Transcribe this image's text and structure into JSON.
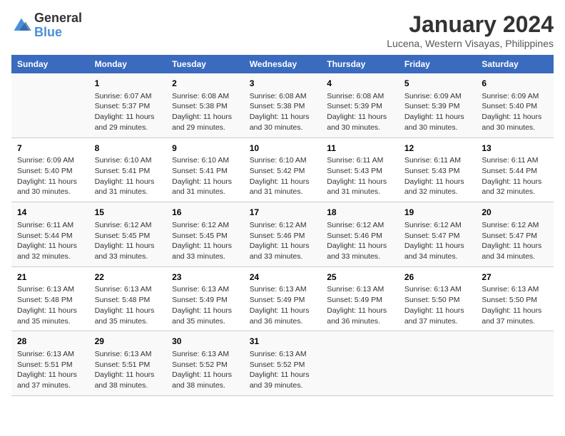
{
  "logo": {
    "text_general": "General",
    "text_blue": "Blue"
  },
  "title": "January 2024",
  "subtitle": "Lucena, Western Visayas, Philippines",
  "header": {
    "days": [
      "Sunday",
      "Monday",
      "Tuesday",
      "Wednesday",
      "Thursday",
      "Friday",
      "Saturday"
    ]
  },
  "weeks": [
    [
      {
        "day": "",
        "info": ""
      },
      {
        "day": "1",
        "info": "Sunrise: 6:07 AM\nSunset: 5:37 PM\nDaylight: 11 hours\nand 29 minutes."
      },
      {
        "day": "2",
        "info": "Sunrise: 6:08 AM\nSunset: 5:38 PM\nDaylight: 11 hours\nand 29 minutes."
      },
      {
        "day": "3",
        "info": "Sunrise: 6:08 AM\nSunset: 5:38 PM\nDaylight: 11 hours\nand 30 minutes."
      },
      {
        "day": "4",
        "info": "Sunrise: 6:08 AM\nSunset: 5:39 PM\nDaylight: 11 hours\nand 30 minutes."
      },
      {
        "day": "5",
        "info": "Sunrise: 6:09 AM\nSunset: 5:39 PM\nDaylight: 11 hours\nand 30 minutes."
      },
      {
        "day": "6",
        "info": "Sunrise: 6:09 AM\nSunset: 5:40 PM\nDaylight: 11 hours\nand 30 minutes."
      }
    ],
    [
      {
        "day": "7",
        "info": "Sunrise: 6:09 AM\nSunset: 5:40 PM\nDaylight: 11 hours\nand 30 minutes."
      },
      {
        "day": "8",
        "info": "Sunrise: 6:10 AM\nSunset: 5:41 PM\nDaylight: 11 hours\nand 31 minutes."
      },
      {
        "day": "9",
        "info": "Sunrise: 6:10 AM\nSunset: 5:41 PM\nDaylight: 11 hours\nand 31 minutes."
      },
      {
        "day": "10",
        "info": "Sunrise: 6:10 AM\nSunset: 5:42 PM\nDaylight: 11 hours\nand 31 minutes."
      },
      {
        "day": "11",
        "info": "Sunrise: 6:11 AM\nSunset: 5:43 PM\nDaylight: 11 hours\nand 31 minutes."
      },
      {
        "day": "12",
        "info": "Sunrise: 6:11 AM\nSunset: 5:43 PM\nDaylight: 11 hours\nand 32 minutes."
      },
      {
        "day": "13",
        "info": "Sunrise: 6:11 AM\nSunset: 5:44 PM\nDaylight: 11 hours\nand 32 minutes."
      }
    ],
    [
      {
        "day": "14",
        "info": "Sunrise: 6:11 AM\nSunset: 5:44 PM\nDaylight: 11 hours\nand 32 minutes."
      },
      {
        "day": "15",
        "info": "Sunrise: 6:12 AM\nSunset: 5:45 PM\nDaylight: 11 hours\nand 33 minutes."
      },
      {
        "day": "16",
        "info": "Sunrise: 6:12 AM\nSunset: 5:45 PM\nDaylight: 11 hours\nand 33 minutes."
      },
      {
        "day": "17",
        "info": "Sunrise: 6:12 AM\nSunset: 5:46 PM\nDaylight: 11 hours\nand 33 minutes."
      },
      {
        "day": "18",
        "info": "Sunrise: 6:12 AM\nSunset: 5:46 PM\nDaylight: 11 hours\nand 33 minutes."
      },
      {
        "day": "19",
        "info": "Sunrise: 6:12 AM\nSunset: 5:47 PM\nDaylight: 11 hours\nand 34 minutes."
      },
      {
        "day": "20",
        "info": "Sunrise: 6:12 AM\nSunset: 5:47 PM\nDaylight: 11 hours\nand 34 minutes."
      }
    ],
    [
      {
        "day": "21",
        "info": "Sunrise: 6:13 AM\nSunset: 5:48 PM\nDaylight: 11 hours\nand 35 minutes."
      },
      {
        "day": "22",
        "info": "Sunrise: 6:13 AM\nSunset: 5:48 PM\nDaylight: 11 hours\nand 35 minutes."
      },
      {
        "day": "23",
        "info": "Sunrise: 6:13 AM\nSunset: 5:49 PM\nDaylight: 11 hours\nand 35 minutes."
      },
      {
        "day": "24",
        "info": "Sunrise: 6:13 AM\nSunset: 5:49 PM\nDaylight: 11 hours\nand 36 minutes."
      },
      {
        "day": "25",
        "info": "Sunrise: 6:13 AM\nSunset: 5:49 PM\nDaylight: 11 hours\nand 36 minutes."
      },
      {
        "day": "26",
        "info": "Sunrise: 6:13 AM\nSunset: 5:50 PM\nDaylight: 11 hours\nand 37 minutes."
      },
      {
        "day": "27",
        "info": "Sunrise: 6:13 AM\nSunset: 5:50 PM\nDaylight: 11 hours\nand 37 minutes."
      }
    ],
    [
      {
        "day": "28",
        "info": "Sunrise: 6:13 AM\nSunset: 5:51 PM\nDaylight: 11 hours\nand 37 minutes."
      },
      {
        "day": "29",
        "info": "Sunrise: 6:13 AM\nSunset: 5:51 PM\nDaylight: 11 hours\nand 38 minutes."
      },
      {
        "day": "30",
        "info": "Sunrise: 6:13 AM\nSunset: 5:52 PM\nDaylight: 11 hours\nand 38 minutes."
      },
      {
        "day": "31",
        "info": "Sunrise: 6:13 AM\nSunset: 5:52 PM\nDaylight: 11 hours\nand 39 minutes."
      },
      {
        "day": "",
        "info": ""
      },
      {
        "day": "",
        "info": ""
      },
      {
        "day": "",
        "info": ""
      }
    ]
  ]
}
